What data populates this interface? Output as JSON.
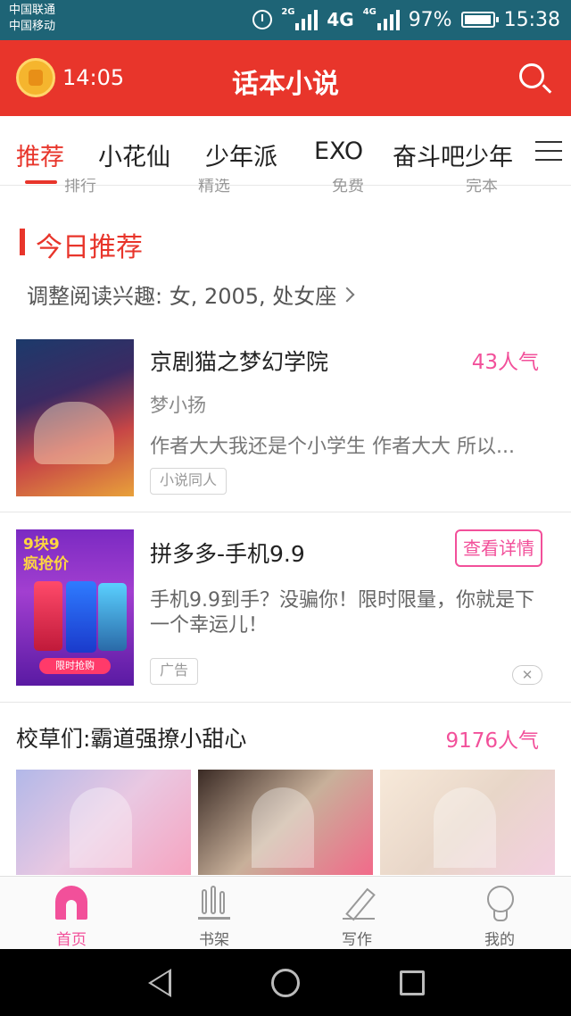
{
  "status_bar": {
    "carrier1": "中国联通",
    "carrier2": "中国移动",
    "net1": "2G",
    "net2": "4G",
    "net2_big": "4G",
    "battery": "97%",
    "time": "15:38"
  },
  "header": {
    "timer": "14:05",
    "title": "话本小说"
  },
  "tabs": [
    "推荐",
    "小花仙",
    "少年派",
    "EXO",
    "奋斗吧少年"
  ],
  "sub_tabs_cut": [
    "排行",
    "精选",
    "免费",
    "完本"
  ],
  "section": {
    "title": "今日推荐",
    "interest": "调整阅读兴趣: 女, 2005, 处女座"
  },
  "book": {
    "title": "京剧猫之梦幻学院",
    "popularity": "43人气",
    "author": "梦小扬",
    "desc": "作者大大我还是个小学生 作者大大 所以...",
    "tag": "小说同人"
  },
  "ad": {
    "title": "拼多多-手机9.9",
    "button": "查看详情",
    "desc": "手机9.9到手？没骗你！限时限量，你就是下一个幸运儿！",
    "tag": "广告",
    "image_headline_1": "9块9",
    "image_headline_2": "疯抢价",
    "image_badge": "限时抢购",
    "close": "✕"
  },
  "collection": {
    "title": "校草们:霸道强撩小甜心",
    "popularity": "9176人气"
  },
  "bottom_nav": [
    "首页",
    "书架",
    "写作",
    "我的"
  ],
  "colors": {
    "header_red": "#e8352b",
    "accent_pink": "#f2509a",
    "status_bar": "#1e6476"
  }
}
